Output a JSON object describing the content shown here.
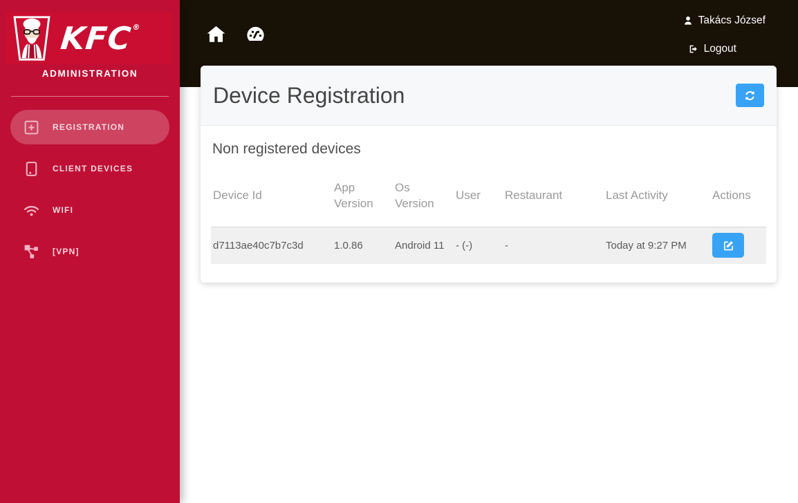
{
  "sidebar": {
    "brand": "KFC",
    "registered_mark": "®",
    "subtitle": "ADMINISTRATION",
    "items": [
      {
        "label": "REGISTRATION",
        "icon": "plus-square-icon",
        "active": true
      },
      {
        "label": "CLIENT DEVICES",
        "icon": "tablet-icon",
        "active": false
      },
      {
        "label": "WIFI",
        "icon": "wifi-icon",
        "active": false
      },
      {
        "label": "[VPN]",
        "icon": "network-icon",
        "active": false
      }
    ]
  },
  "topbar": {
    "nav_icons": [
      "home-icon",
      "dashboard-icon"
    ],
    "user_name": "Takács József",
    "user_icon": "user-icon",
    "logout_label": "Logout",
    "logout_icon": "logout-icon"
  },
  "page": {
    "title": "Device Registration",
    "refresh_icon": "sync-icon",
    "section_title": "Non registered devices"
  },
  "table": {
    "columns": [
      "Device Id",
      "App Version",
      "Os Version",
      "User",
      "Restaurant",
      "Last Activity",
      "Actions"
    ],
    "rows": [
      {
        "device_id": "d7113ae40c7b7c3d",
        "app_version": "1.0.86",
        "os_version": "Android 11",
        "user": "- (-)",
        "restaurant": "-",
        "last_activity": "Today at 9:27 PM",
        "action_icon": "edit-icon"
      }
    ]
  },
  "colors": {
    "sidebar_red": "#bf0f34",
    "logo_red": "#c90e31",
    "topbar_dark": "#181106",
    "accent_blue": "#38a3f5",
    "active_item_overlay": "rgba(255,255,255,0.22)",
    "row_stripe": "#f0f0f0"
  }
}
